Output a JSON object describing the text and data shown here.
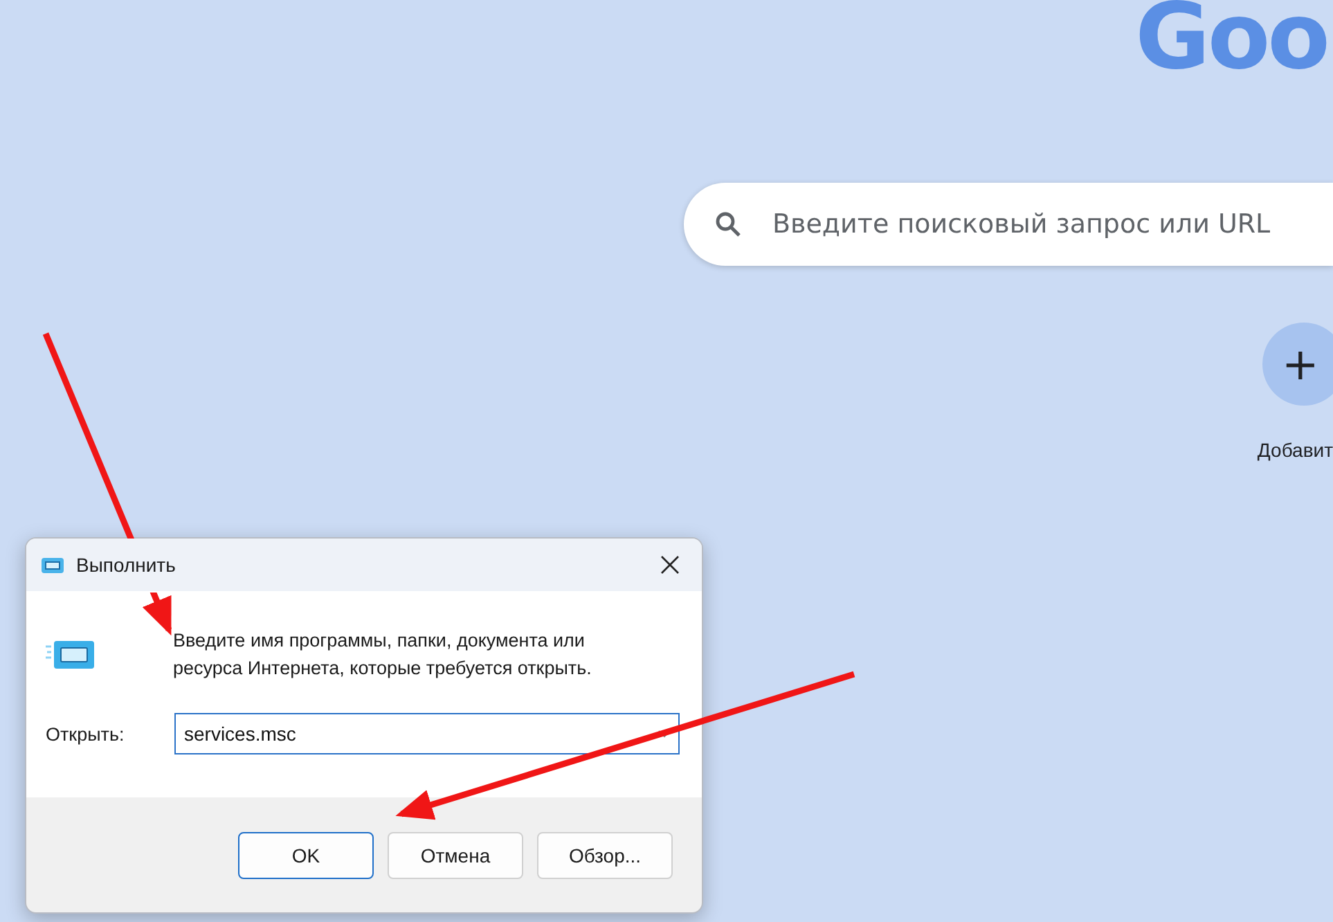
{
  "browser": {
    "logo": "Goo",
    "search": {
      "placeholder": "Введите поисковый запрос или URL"
    },
    "shortcut_add": {
      "icon": "+",
      "label": "Добавит"
    }
  },
  "dialog": {
    "title": "Выполнить",
    "prompt": "Введите имя программы, папки, документа или ресурса Интернета, которые требуется открыть.",
    "open_label": "Открыть:",
    "command": {
      "value": "services.msc"
    },
    "buttons": [
      {
        "label": "OK",
        "default": true
      },
      {
        "label": "Отмена",
        "default": false
      },
      {
        "label": "Обзор...",
        "default": false
      }
    ]
  }
}
